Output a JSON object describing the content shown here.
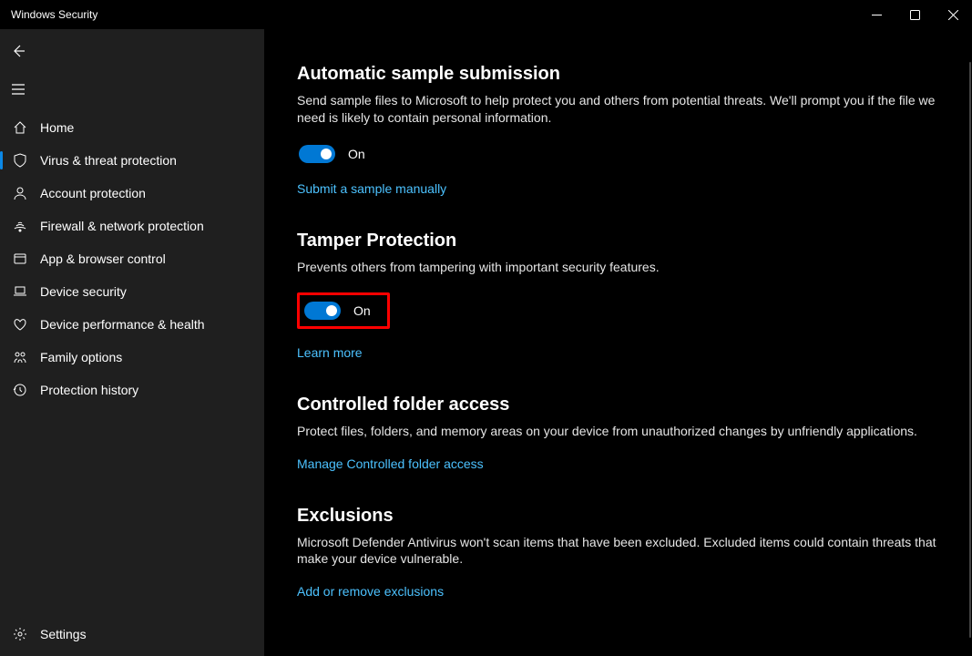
{
  "titlebar": {
    "title": "Windows Security"
  },
  "sidebar": {
    "items": [
      {
        "id": "home",
        "label": "Home"
      },
      {
        "id": "virus",
        "label": "Virus & threat protection"
      },
      {
        "id": "account",
        "label": "Account protection"
      },
      {
        "id": "firewall",
        "label": "Firewall & network protection"
      },
      {
        "id": "appbrowser",
        "label": "App & browser control"
      },
      {
        "id": "devicesec",
        "label": "Device security"
      },
      {
        "id": "perf",
        "label": "Device performance & health"
      },
      {
        "id": "family",
        "label": "Family options"
      },
      {
        "id": "history",
        "label": "Protection history"
      }
    ],
    "settings_label": "Settings"
  },
  "sections": {
    "auto_sample": {
      "title": "Automatic sample submission",
      "desc": "Send sample files to Microsoft to help protect you and others from potential threats. We'll prompt you if the file we need is likely to contain personal information.",
      "toggle_state": "On",
      "link": "Submit a sample manually"
    },
    "tamper": {
      "title": "Tamper Protection",
      "desc": "Prevents others from tampering with important security features.",
      "toggle_state": "On",
      "link": "Learn more"
    },
    "cfa": {
      "title": "Controlled folder access",
      "desc": "Protect files, folders, and memory areas on your device from unauthorized changes by unfriendly applications.",
      "link": "Manage Controlled folder access"
    },
    "exclusions": {
      "title": "Exclusions",
      "desc": "Microsoft Defender Antivirus won't scan items that have been excluded. Excluded items could contain threats that make your device vulnerable.",
      "link": "Add or remove exclusions"
    }
  }
}
